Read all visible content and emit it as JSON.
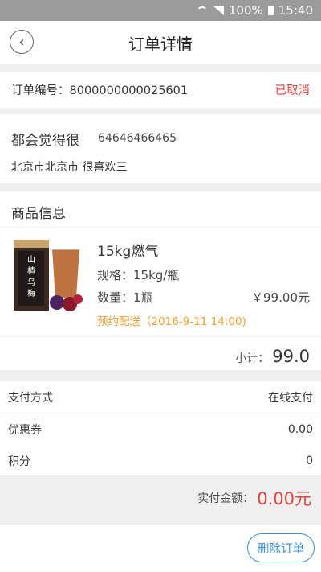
{
  "status_bar": {
    "battery": "100%",
    "time": "15:40"
  },
  "header": {
    "title": "订单详情",
    "back_icon": "chevron-left-icon"
  },
  "order": {
    "number_label": "订单编号：8000000000025601",
    "status": "已取消"
  },
  "address": {
    "name": "都会觉得很",
    "phone": "64646466465",
    "address": "北京市北京市 很喜欢三"
  },
  "goods": {
    "section_title": "商品信息",
    "item": {
      "name": "15kg燃气",
      "spec": "规格：15kg/瓶",
      "qty": "数量：1瓶",
      "price": "￥99.00元",
      "delivery": "预约配送（2016-9-11 14:00)"
    },
    "subtotal_label": "小计：",
    "subtotal_value": "99.0"
  },
  "payment": {
    "rows": [
      {
        "label": "支付方式",
        "value": "在线支付"
      },
      {
        "label": "优惠券",
        "value": "0.00"
      },
      {
        "label": "积分",
        "value": "0"
      }
    ],
    "actual_label": "实付金额：",
    "actual_value": "0.00元"
  },
  "actions": {
    "delete_label": "删除订单"
  },
  "colors": {
    "accent_red": "#e8403a",
    "accent_orange": "#f2a033",
    "accent_blue": "#3a8fd9"
  }
}
